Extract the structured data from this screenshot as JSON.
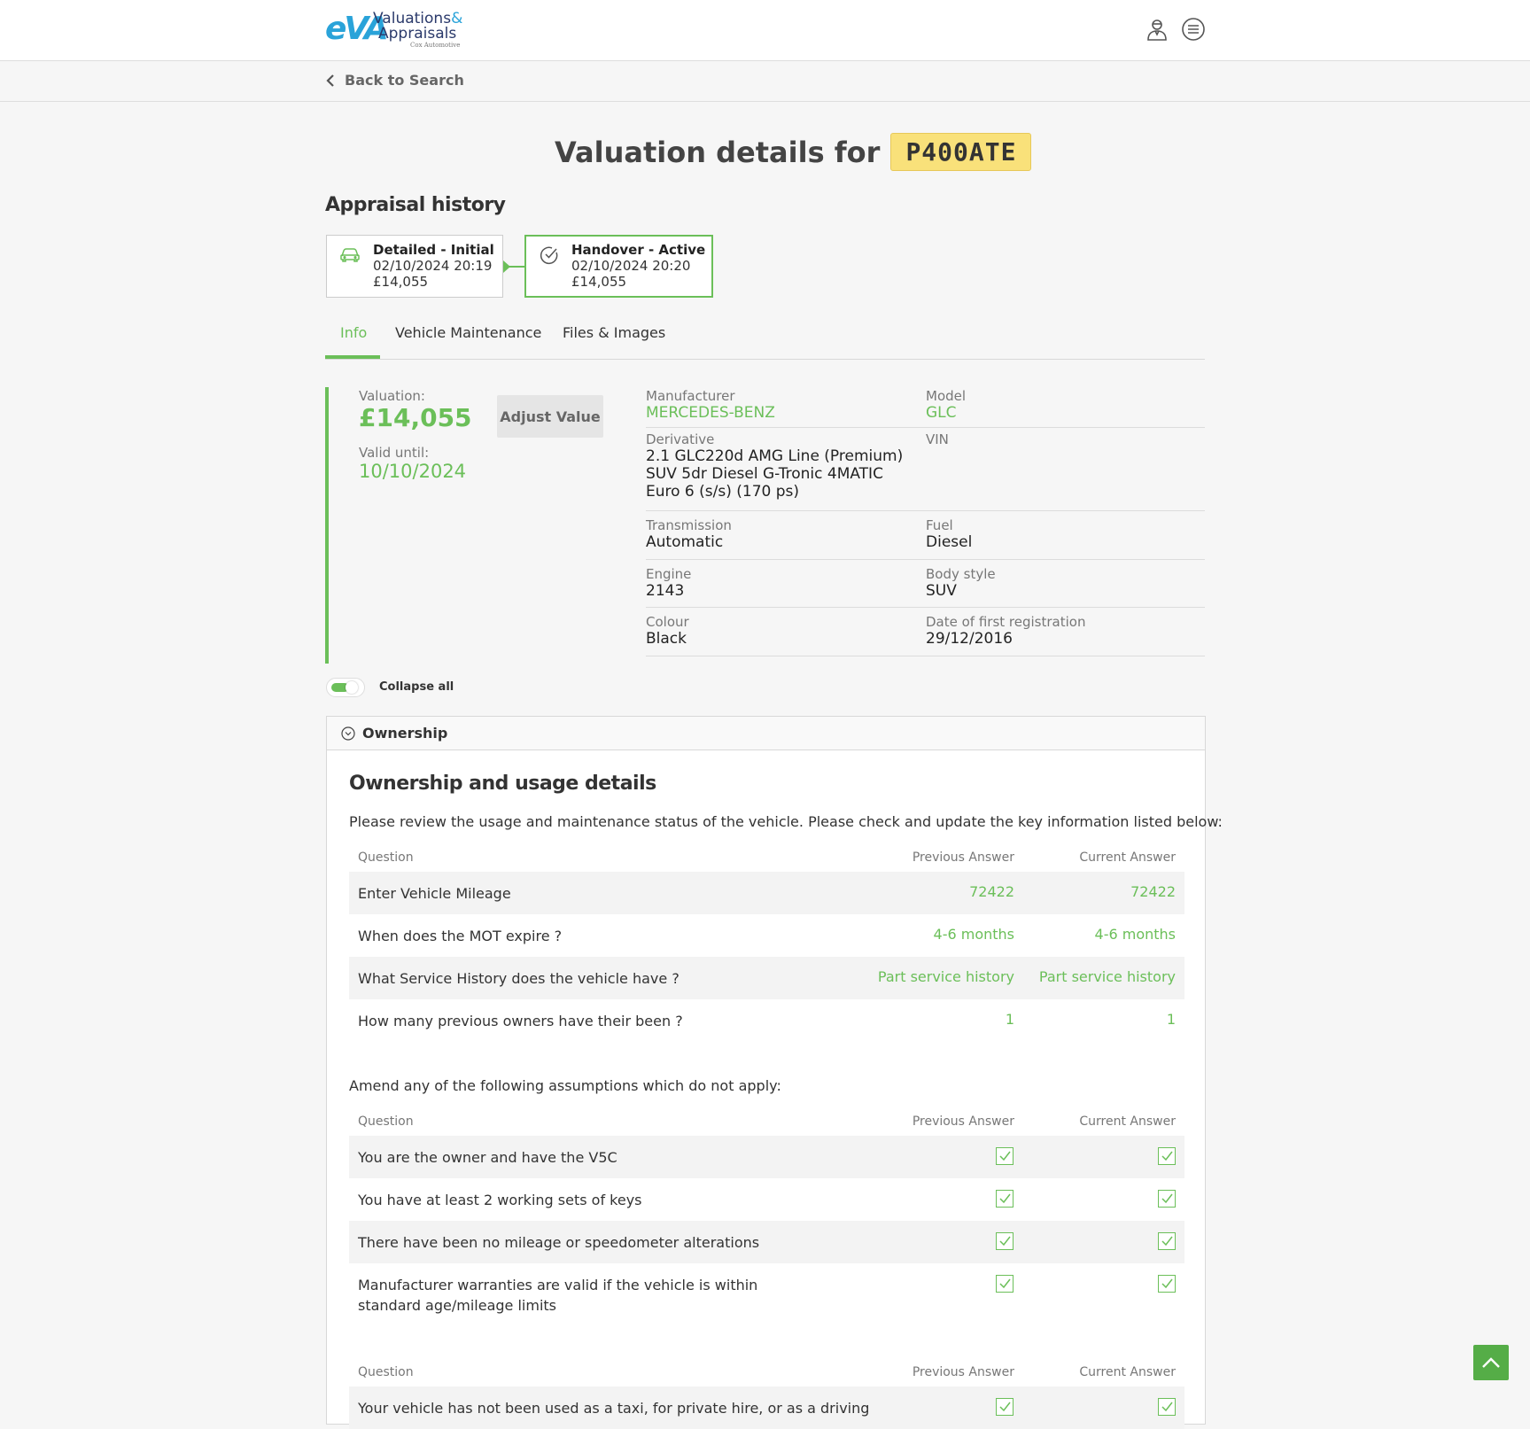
{
  "logo": {
    "mark": "eVA",
    "line1": "Valuations",
    "amp": "&",
    "line2": "Appraisals",
    "line3": "Cox Automotive"
  },
  "header": {
    "user_icon": "user-icon",
    "menu_icon": "menu-icon"
  },
  "nav": {
    "back_label": "Back to Search"
  },
  "title": {
    "text": "Valuation details for",
    "plate": "P400ATE"
  },
  "appraisal_history": {
    "title": "Appraisal history",
    "cards": [
      {
        "title": "Detailed - Initial",
        "datetime": "02/10/2024 20:19",
        "value": "£14,055",
        "icon": "car-icon"
      },
      {
        "title": "Handover - Active",
        "datetime": "02/10/2024 20:20",
        "value": "£14,055",
        "icon": "check-circle-icon"
      }
    ]
  },
  "tabs": [
    {
      "label": "Info",
      "active": true
    },
    {
      "label": "Vehicle Maintenance",
      "active": false
    },
    {
      "label": "Files & Images",
      "active": false
    }
  ],
  "valuation": {
    "label": "Valuation:",
    "value": "£14,055",
    "valid_label": "Valid until:",
    "valid_date": "10/10/2024",
    "adjust_label": "Adjust Value"
  },
  "specs": {
    "manufacturer": {
      "label": "Manufacturer",
      "value": "MERCEDES-BENZ"
    },
    "model": {
      "label": "Model",
      "value": "GLC"
    },
    "derivative": {
      "label": "Derivative",
      "value": "2.1 GLC220d AMG Line (Premium) SUV 5dr Diesel G-Tronic 4MATIC Euro 6 (s/s) (170 ps)"
    },
    "vin": {
      "label": "VIN",
      "value": ""
    },
    "transmission": {
      "label": "Transmission",
      "value": "Automatic"
    },
    "fuel": {
      "label": "Fuel",
      "value": "Diesel"
    },
    "engine": {
      "label": "Engine",
      "value": "2143"
    },
    "body_style": {
      "label": "Body style",
      "value": "SUV"
    },
    "colour": {
      "label": "Colour",
      "value": "Black"
    },
    "first_reg": {
      "label": "Date of first registration",
      "value": "29/12/2016"
    }
  },
  "collapse": {
    "label": "Collapse all",
    "on": true
  },
  "ownership": {
    "accordion_label": "Ownership",
    "title": "Ownership and usage details",
    "intro": "Please review the usage and maintenance status of the vehicle. Please check and update the key information listed below:",
    "columns": {
      "question": "Question",
      "previous": "Previous Answer",
      "current": "Current Answer"
    },
    "rows": [
      {
        "q": "Enter Vehicle Mileage",
        "prev": "72422",
        "curr": "72422"
      },
      {
        "q": "When does the MOT expire ?",
        "prev": "4-6 months",
        "curr": "4-6 months"
      },
      {
        "q": "What Service History does the vehicle have ?",
        "prev": "Part service history",
        "curr": "Part service history"
      },
      {
        "q": "How many previous owners have their been ?",
        "prev": "1",
        "curr": "1"
      }
    ],
    "assumptions_intro": "Amend any of the following assumptions which do not apply:",
    "assumptions": [
      {
        "q": "You are the owner and have the V5C",
        "prev": true,
        "curr": true
      },
      {
        "q": "You have at least 2 working sets of keys",
        "prev": true,
        "curr": true
      },
      {
        "q": "There have been no mileage or speedometer alterations",
        "prev": true,
        "curr": true
      },
      {
        "q": "Manufacturer warranties are valid if the vehicle is within standard age/mileage limits",
        "prev": true,
        "curr": true
      }
    ],
    "usage": [
      {
        "q": "Your vehicle has not been used as a taxi, for private hire, or as a driving",
        "prev": true,
        "curr": true
      }
    ]
  },
  "colors": {
    "accent": "#6bbf59",
    "plate": "#f9e17a",
    "logo_blue": "#2aa3d9"
  },
  "scroll_top_icon": "chevron-up-icon"
}
